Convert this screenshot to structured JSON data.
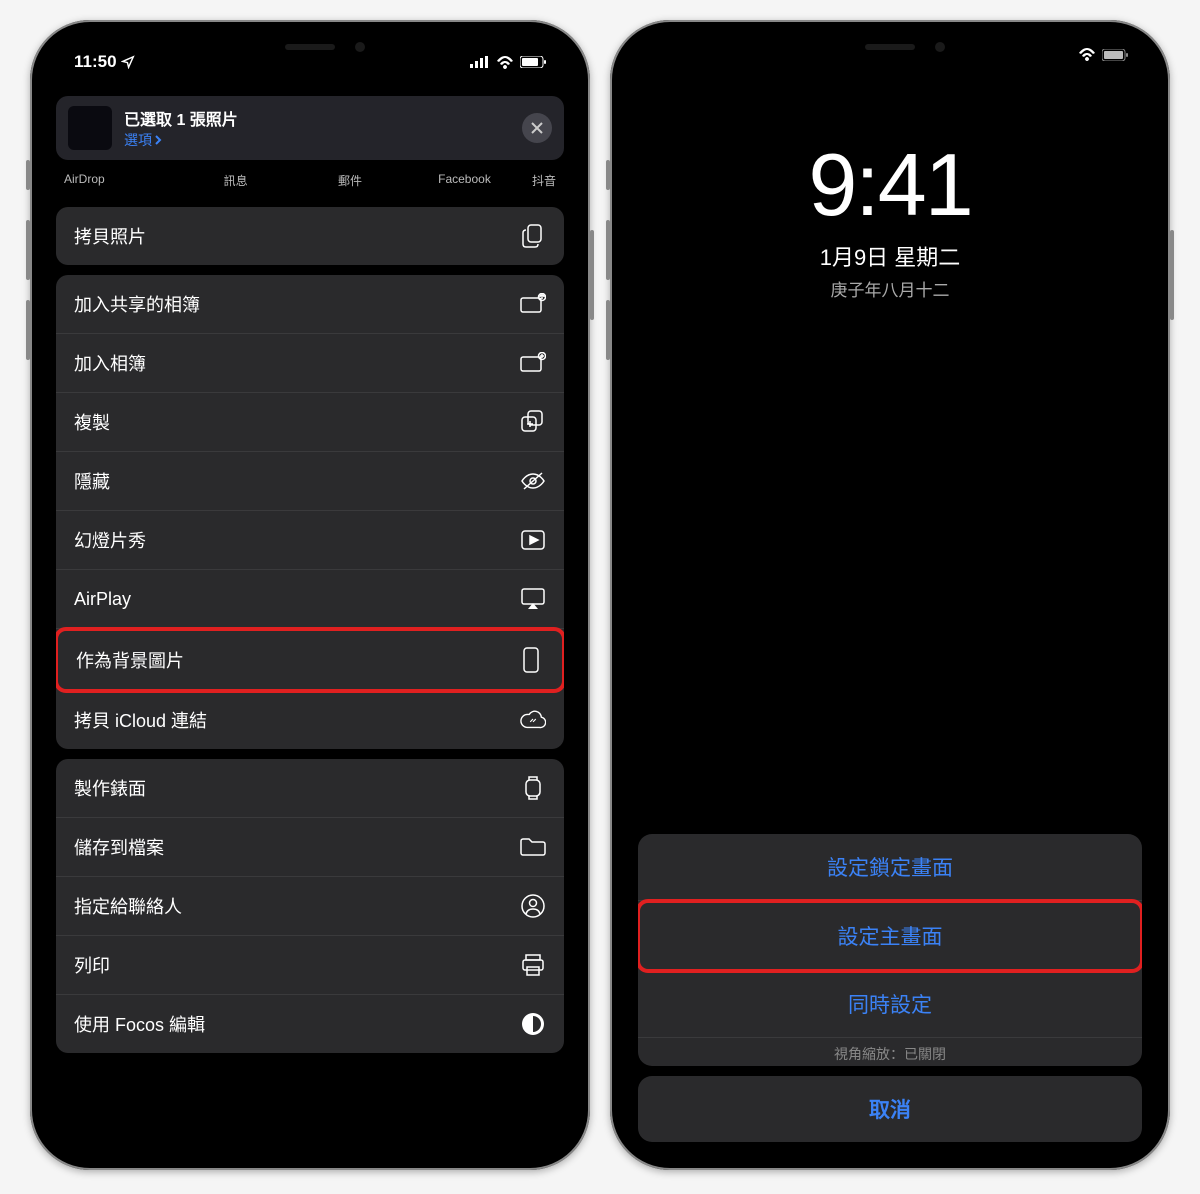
{
  "left": {
    "statusbar": {
      "time": "11:50"
    },
    "share": {
      "title": "已選取 1 張照片",
      "options_label": "選項"
    },
    "apps": {
      "airdrop": "AirDrop",
      "message": "訊息",
      "mail": "郵件",
      "facebook": "Facebook",
      "tail": "抖音"
    },
    "group1": {
      "copy_photo": "拷貝照片"
    },
    "group2": {
      "add_shared_album": "加入共享的相簿",
      "add_album": "加入相簿",
      "duplicate": "複製",
      "hide": "隱藏",
      "slideshow": "幻燈片秀",
      "airplay": "AirPlay",
      "use_as_wallpaper": "作為背景圖片",
      "copy_icloud_link": "拷貝 iCloud 連結"
    },
    "group3": {
      "create_watchface": "製作錶面",
      "save_to_files": "儲存到檔案",
      "assign_contact": "指定給聯絡人",
      "print": "列印",
      "edit_focos": "使用 Focos 編輯"
    }
  },
  "right": {
    "lock": {
      "time": "9:41",
      "date": "1月9日 星期二",
      "date2": "庚子年八月十二"
    },
    "sheet": {
      "set_lock": "設定鎖定畫面",
      "set_home": "設定主畫面",
      "set_both": "同時設定",
      "perspective": "視角縮放：已關閉",
      "cancel": "取消"
    }
  }
}
